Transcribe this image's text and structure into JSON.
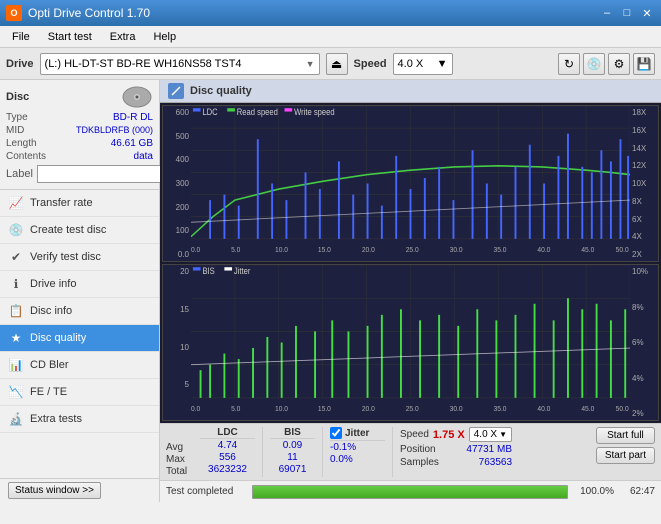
{
  "titlebar": {
    "title": "Opti Drive Control 1.70",
    "icon": "ODC",
    "min_btn": "–",
    "max_btn": "□",
    "close_btn": "✕"
  },
  "menubar": {
    "items": [
      "File",
      "Start test",
      "Extra",
      "Help"
    ]
  },
  "drivebar": {
    "label": "Drive",
    "drive_text": "(L:)  HL-DT-ST BD-RE  WH16NS58 TST4",
    "eject_icon": "⏏",
    "speed_label": "Speed",
    "speed_value": "4.0 X"
  },
  "disc": {
    "title": "Disc",
    "type_label": "Type",
    "type_value": "BD-R DL",
    "mid_label": "MID",
    "mid_value": "TDKBLDRFB (000)",
    "length_label": "Length",
    "length_value": "46.61 GB",
    "contents_label": "Contents",
    "contents_value": "data",
    "label_label": "Label",
    "label_value": ""
  },
  "nav": {
    "items": [
      {
        "id": "transfer-rate",
        "label": "Transfer rate",
        "icon": "📈"
      },
      {
        "id": "create-test-disc",
        "label": "Create test disc",
        "icon": "💿"
      },
      {
        "id": "verify-test-disc",
        "label": "Verify test disc",
        "icon": "✔"
      },
      {
        "id": "drive-info",
        "label": "Drive info",
        "icon": "ℹ"
      },
      {
        "id": "disc-info",
        "label": "Disc info",
        "icon": "📋"
      },
      {
        "id": "disc-quality",
        "label": "Disc quality",
        "icon": "★",
        "active": true
      },
      {
        "id": "cd-bler",
        "label": "CD Bler",
        "icon": "📊"
      },
      {
        "id": "fe-te",
        "label": "FE / TE",
        "icon": "📉"
      },
      {
        "id": "extra-tests",
        "label": "Extra tests",
        "icon": "🔬"
      }
    ]
  },
  "status": {
    "btn_label": "Status window >>",
    "status_text": "Test completed",
    "progress_pct": "100.0%",
    "time": "62:47"
  },
  "chart": {
    "title": "Disc quality",
    "top_legend": [
      {
        "label": "LDC",
        "color": "#4466ff"
      },
      {
        "label": "Read speed",
        "color": "#44cc44"
      },
      {
        "label": "Write speed",
        "color": "#ff44ff"
      }
    ],
    "top_y_left": [
      "600",
      "500",
      "400",
      "300",
      "200",
      "100",
      "0.0"
    ],
    "top_y_right": [
      "18X",
      "16X",
      "14X",
      "12X",
      "10X",
      "8X",
      "6X",
      "4X",
      "2X"
    ],
    "bottom_legend": [
      {
        "label": "BIS",
        "color": "#4466ff"
      },
      {
        "label": "Jitter",
        "color": "#ffffff"
      }
    ],
    "bottom_y_left": [
      "20",
      "15",
      "10",
      "5",
      ""
    ],
    "bottom_y_right": [
      "10%",
      "8%",
      "6%",
      "4%",
      "2%"
    ],
    "x_labels": [
      "0.0",
      "5.0",
      "10.0",
      "15.0",
      "20.0",
      "25.0",
      "30.0",
      "35.0",
      "40.0",
      "45.0",
      "50.0 GB"
    ]
  },
  "stats": {
    "ldc_label": "LDC",
    "bis_label": "BIS",
    "jitter_label": "Jitter",
    "jitter_checked": true,
    "avg_label": "Avg",
    "max_label": "Max",
    "total_label": "Total",
    "ldc_avg": "4.74",
    "ldc_max": "556",
    "ldc_total": "3623232",
    "bis_avg": "0.09",
    "bis_max": "11",
    "bis_total": "69071",
    "jitter_avg": "-0.1%",
    "jitter_max": "0.0%",
    "jitter_total": "",
    "speed_label": "Speed",
    "speed_value": "1.75 X",
    "speed_select": "4.0 X",
    "position_label": "Position",
    "position_value": "47731 MB",
    "samples_label": "Samples",
    "samples_value": "763563",
    "start_full_label": "Start full",
    "start_part_label": "Start part"
  }
}
